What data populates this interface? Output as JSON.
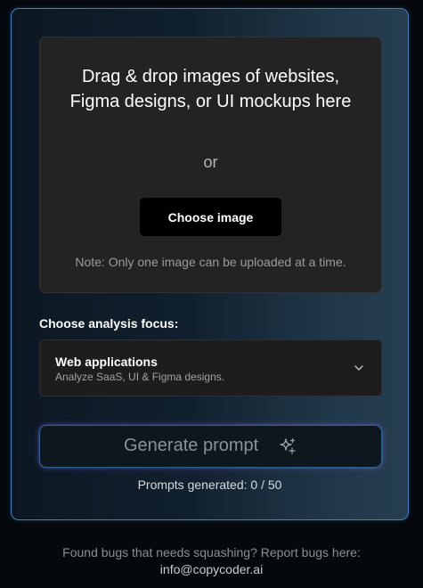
{
  "dropzone": {
    "title": "Drag & drop images of websites, Figma designs, or UI mockups here",
    "or_text": "or",
    "choose_button": "Choose image",
    "note": "Note: Only one image can be uploaded at a time."
  },
  "analysis": {
    "label": "Choose analysis focus:",
    "selected_title": "Web applications",
    "selected_subtitle": "Analyze SaaS, UI & Figma designs."
  },
  "generate": {
    "label": "Generate prompt",
    "icon": "sparkle-icon"
  },
  "prompts": {
    "text": "Prompts generated: 0 / 50",
    "used": 0,
    "limit": 50
  },
  "footer": {
    "text": "Found bugs that needs squashing? Report bugs here:",
    "email": "info@copycoder.ai"
  },
  "colors": {
    "page_background": "#05090d",
    "card_border": "#3d82c4",
    "dropzone_background": "#232323",
    "button_background": "#000000",
    "accent_glow": "#7a5adc"
  }
}
